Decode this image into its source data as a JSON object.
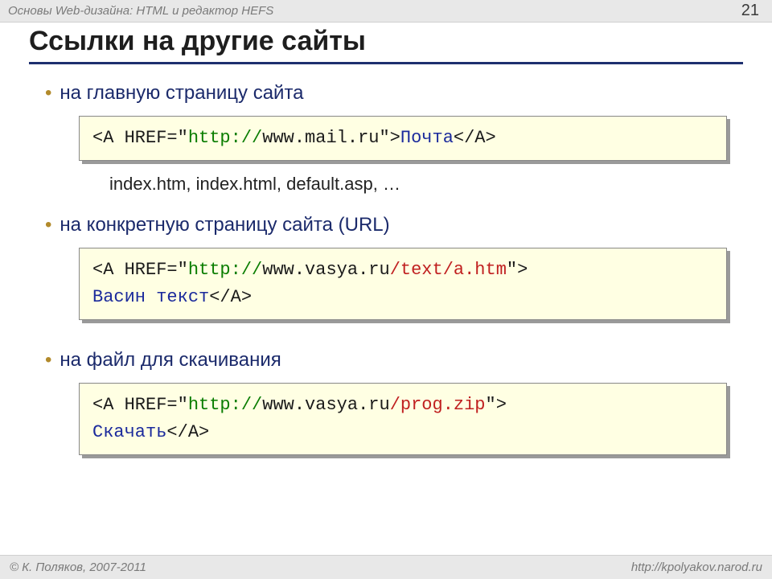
{
  "header": {
    "lecture": "Основы Web-дизайна: HTML и редактор HEFS",
    "page_number": "21"
  },
  "title": "Ссылки на другие сайты",
  "sections": [
    {
      "bullet": "на главную страницу сайта",
      "code": {
        "prefix": "<A HREF=\"",
        "green": "http://",
        "mid": "www.mail.ru",
        "red": "",
        "suffix1": "\">",
        "linktext": "Почта",
        "suffix2": "</A>"
      },
      "note": "index.htm, index.html, default.asp, …"
    },
    {
      "bullet": "на конкретную страницу сайта (URL)",
      "code": {
        "prefix": "<A HREF=\"",
        "green": "http://",
        "mid": "www.vasya.ru",
        "red": "/text/a.htm",
        "suffix1": "\">",
        "linktext": "Васин текст",
        "suffix2": "</A>"
      }
    },
    {
      "bullet": "на файл для скачивания",
      "code": {
        "prefix": "<A HREF=\"",
        "green": "http://",
        "mid": "www.vasya.ru",
        "red": "/prog.zip",
        "suffix1": "\">",
        "linktext": "Скачать",
        "suffix2": "</A>"
      }
    }
  ],
  "footer": {
    "left": "© К. Поляков, 2007-2011",
    "right": "http://kpolyakov.narod.ru"
  }
}
